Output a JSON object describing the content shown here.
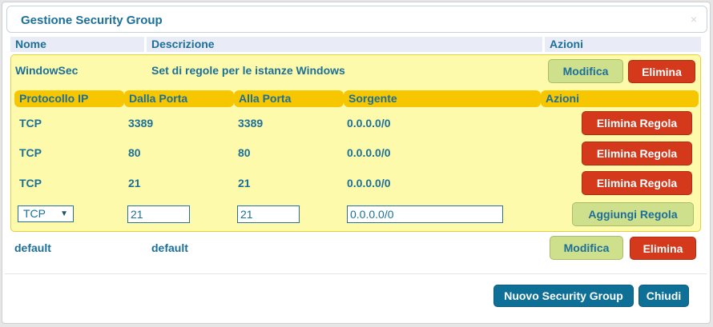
{
  "dialog": {
    "title": "Gestione Security Group",
    "close_icon": "×"
  },
  "columns": {
    "name": "Nome",
    "description": "Descrizione",
    "actions": "Azioni"
  },
  "groups": [
    {
      "name": "WindowSec",
      "description": "Set di regole per le istanze Windows",
      "edit_label": "Modifica",
      "delete_label": "Elimina",
      "rules_header": {
        "protocol": "Protocollo IP",
        "from_port": "Dalla Porta",
        "to_port": "Alla Porta",
        "source": "Sorgente",
        "actions": "Azioni"
      },
      "rules": [
        {
          "protocol": "TCP",
          "from_port": "3389",
          "to_port": "3389",
          "source": "0.0.0.0/0",
          "delete_label": "Elimina Regola"
        },
        {
          "protocol": "TCP",
          "from_port": "80",
          "to_port": "80",
          "source": "0.0.0.0/0",
          "delete_label": "Elimina Regola"
        },
        {
          "protocol": "TCP",
          "from_port": "21",
          "to_port": "21",
          "source": "0.0.0.0/0",
          "delete_label": "Elimina Regola"
        }
      ],
      "new_rule": {
        "protocol": "TCP",
        "from_port": "21",
        "to_port": "21",
        "source": "0.0.0.0/0",
        "add_label": "Aggiungi Regola"
      }
    },
    {
      "name": "default",
      "description": "default",
      "edit_label": "Modifica",
      "delete_label": "Elimina"
    }
  ],
  "footer": {
    "new_group_label": "Nuovo Security Group",
    "close_label": "Chiudi"
  },
  "colors": {
    "accent": "#1b6f98",
    "highlight_bg": "#fdfbab",
    "subheader_bg": "#f6c700",
    "danger": "#d4391c",
    "secondary": "#cfe08c"
  }
}
